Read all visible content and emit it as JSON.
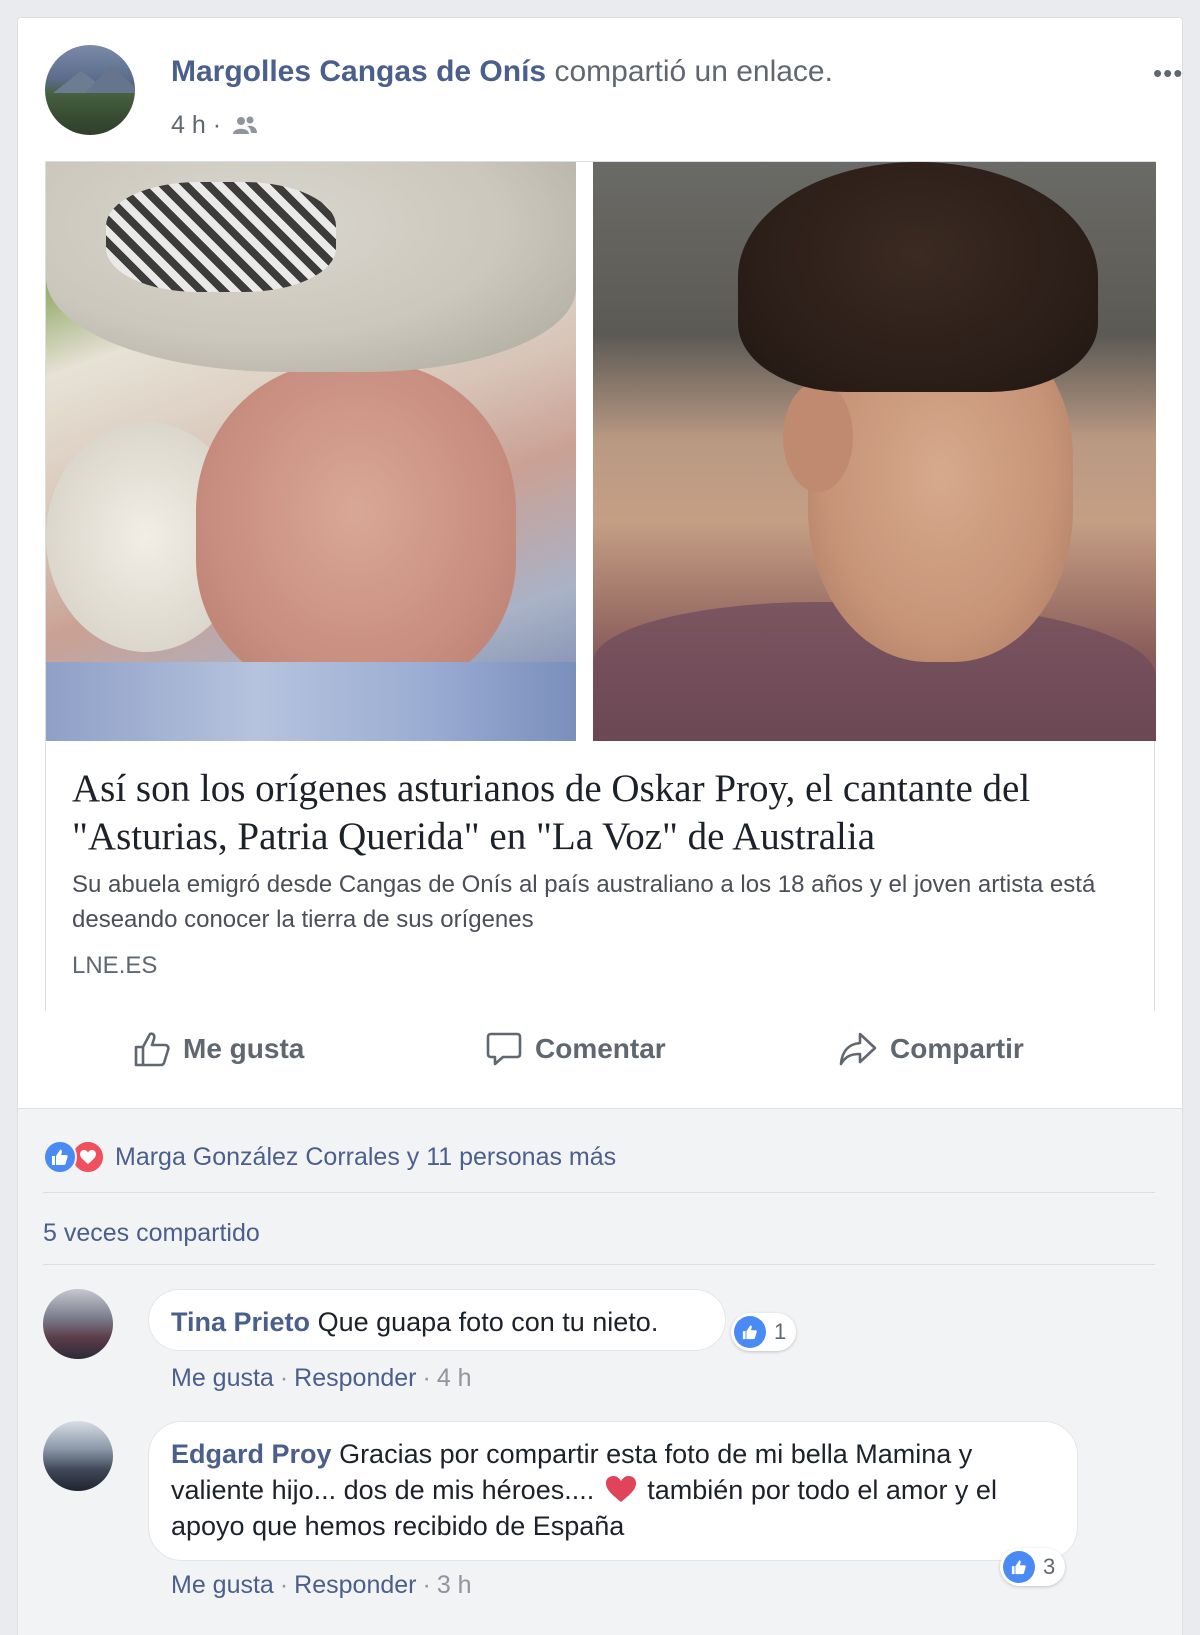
{
  "post": {
    "author": "Margolles Cangas de Onís",
    "shared_text": "compartió un enlace.",
    "time": "4 h",
    "separator": "·",
    "audience_icon": "friends-icon",
    "more_icon": "•••"
  },
  "link": {
    "title": "Así son los orígenes asturianos de Oskar Proy, el cantante del \"Asturias, Patria Querida\" en \"La Voz\" de Australia",
    "description": "Su abuela emigró desde Cangas de Onís al país australiano a los 18 años y el joven artista está deseando conocer la tierra de sus orígenes",
    "domain": "LNE.ES"
  },
  "actions": {
    "like": "Me gusta",
    "comment": "Comentar",
    "share": "Compartir"
  },
  "reactions": {
    "text": "Marga González Corrales y 11 personas más"
  },
  "shares": {
    "text": "5 veces compartido"
  },
  "comments": [
    {
      "name": "Tina Prieto",
      "text": "Que guapa foto con tu nieto.",
      "reaction_count": "1",
      "like": "Me gusta",
      "reply": "Responder",
      "time": "4 h"
    },
    {
      "name": "Edgard Proy",
      "text_before_heart": "Gracias por compartir esta foto de mi bella Mamina y valiente hijo... dos de mis héroes....",
      "text_after_heart": "también por todo el amor y el apoyo que hemos recibido de España",
      "reaction_count": "3",
      "like": "Me gusta",
      "reply": "Responder",
      "time": "3 h"
    }
  ],
  "colors": {
    "link_blue": "#4b5f8c",
    "like_blue": "#4a8af4",
    "love_red": "#f0505e",
    "meta_gray": "#606770"
  }
}
